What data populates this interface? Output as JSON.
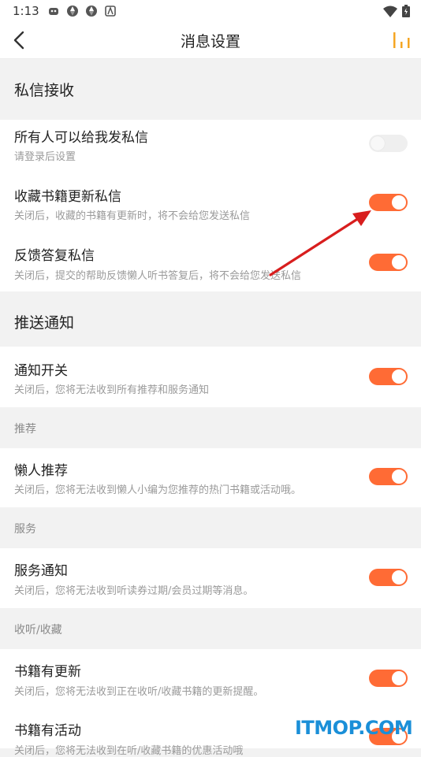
{
  "status_bar": {
    "time": "1:13",
    "left_icons": [
      "game-icon",
      "aperture-icon",
      "aperture-icon",
      "app-icon"
    ],
    "right_icons": [
      "wifi-icon",
      "battery-icon"
    ]
  },
  "header": {
    "title": "消息设置"
  },
  "sections": {
    "private_message": {
      "heading": "私信接收",
      "items": [
        {
          "title": "所有人可以给我发私信",
          "desc": "请登录后设置",
          "enabled": false
        },
        {
          "title": "收藏书籍更新私信",
          "desc": "关闭后，收藏的书籍有更新时，将不会给您发送私信",
          "enabled": true
        },
        {
          "title": "反馈答复私信",
          "desc": "关闭后，提交的帮助反馈懒人听书答复后，将不会给您发送私信",
          "enabled": true
        }
      ]
    },
    "push": {
      "heading": "推送通知",
      "items": [
        {
          "title": "通知开关",
          "desc": "关闭后，您将无法收到所有推荐和服务通知",
          "enabled": true
        }
      ]
    },
    "recommend": {
      "heading": "推荐",
      "items": [
        {
          "title": "懒人推荐",
          "desc": "关闭后，您将无法收到懒人小编为您推荐的热门书籍或活动哦。",
          "enabled": true
        }
      ]
    },
    "service": {
      "heading": "服务",
      "items": [
        {
          "title": "服务通知",
          "desc": "关闭后，您将无法收到听读券过期/会员过期等消息。",
          "enabled": true
        }
      ]
    },
    "listen_collect": {
      "heading": "收听/收藏",
      "items": [
        {
          "title": "书籍有更新",
          "desc": "关闭后，您将无法收到正在收听/收藏书籍的更新提醒。",
          "enabled": true
        },
        {
          "title": "书籍有活动",
          "desc": "关闭后，您将无法收到在听/收藏书籍的优惠活动哦",
          "enabled": true
        }
      ]
    }
  },
  "colors": {
    "accent": "#ff6b35",
    "arrow": "#d81e1e",
    "watermark": "#1a8fd8"
  },
  "watermark": "ITMOP.COM"
}
